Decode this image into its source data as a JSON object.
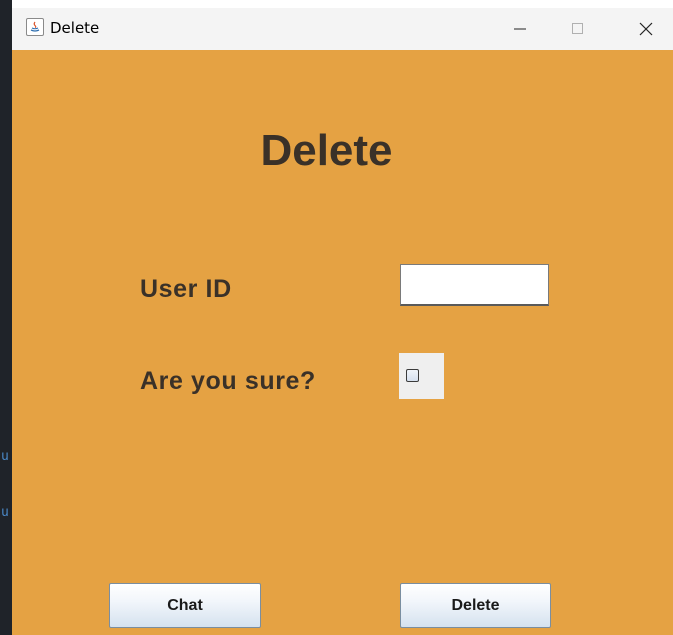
{
  "window": {
    "title": "Delete",
    "controls": {
      "minimize_icon": "minimize-icon",
      "maximize_icon": "maximize-icon",
      "close_icon": "close-icon"
    }
  },
  "background_edge": {
    "glyphs": [
      "u",
      "u"
    ]
  },
  "form": {
    "heading": "Delete",
    "user_id_label": "User ID",
    "user_id_value": "",
    "confirm_label": "Are you sure?",
    "confirm_checked": false
  },
  "buttons": {
    "chat_label": "Chat",
    "delete_label": "Delete"
  },
  "colors": {
    "panel_background": "#e5a243",
    "label_text": "#3a3128",
    "titlebar": "#f4f4f4"
  }
}
